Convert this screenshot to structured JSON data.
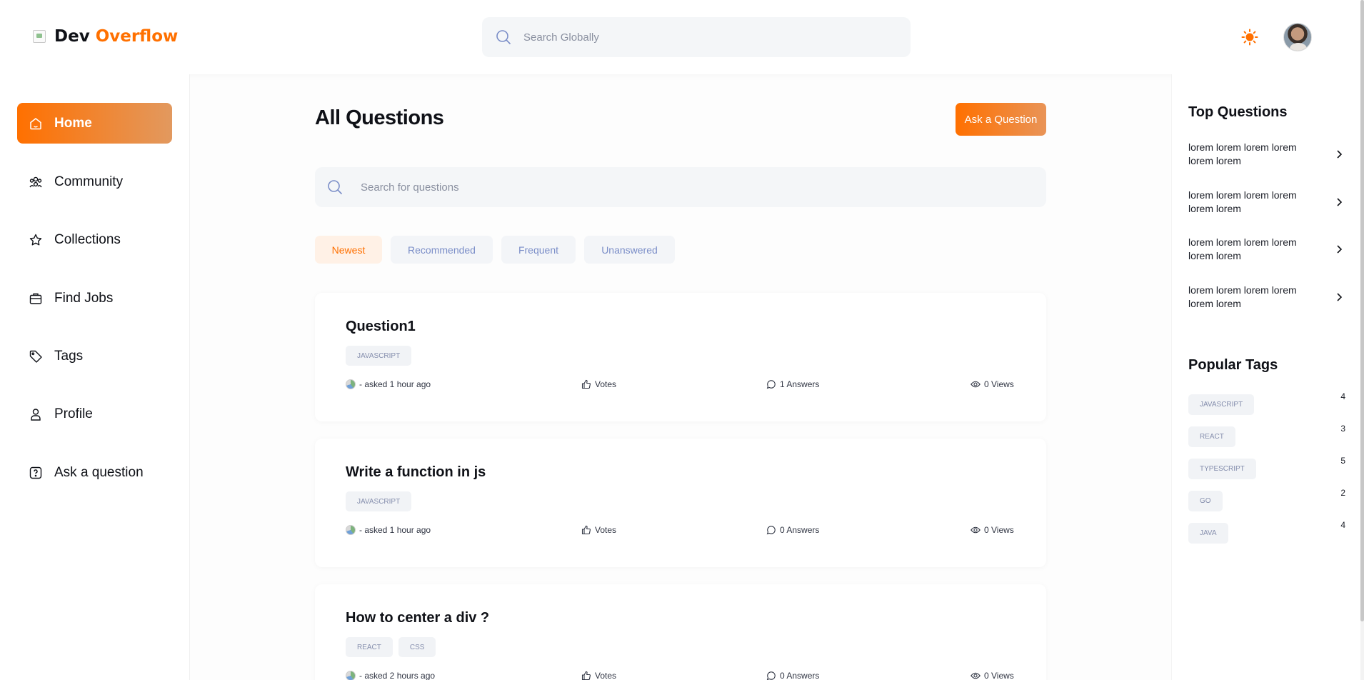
{
  "header": {
    "logo_left": "Dev",
    "logo_right": "Overflow",
    "search_placeholder": "Search Globally"
  },
  "sidebar": {
    "items": [
      {
        "label": "Home",
        "icon": "home-icon",
        "active": true
      },
      {
        "label": "Community",
        "icon": "users-icon"
      },
      {
        "label": "Collections",
        "icon": "star-icon"
      },
      {
        "label": "Find Jobs",
        "icon": "briefcase-icon"
      },
      {
        "label": "Tags",
        "icon": "tag-icon"
      },
      {
        "label": "Profile",
        "icon": "user-icon"
      },
      {
        "label": "Ask a question",
        "icon": "question-icon"
      }
    ]
  },
  "main": {
    "title": "All Questions",
    "ask_button": "Ask a Question",
    "search_placeholder": "Search for questions",
    "filters": [
      "Newest",
      "Recommended",
      "Frequent",
      "Unanswered"
    ],
    "questions": [
      {
        "title": "Question1",
        "tags": [
          "JAVASCRIPT"
        ],
        "asked": "- asked 1 hour ago",
        "votes": "Votes",
        "answers": "1 Answers",
        "views": "0 Views"
      },
      {
        "title": "Write a function in js",
        "tags": [
          "JAVASCRIPT"
        ],
        "asked": "- asked 1 hour ago",
        "votes": "Votes",
        "answers": "0 Answers",
        "views": "0 Views"
      },
      {
        "title": "How to center a div ?",
        "tags": [
          "REACT",
          "CSS"
        ],
        "asked": "- asked 2 hours ago",
        "votes": "Votes",
        "answers": "0 Answers",
        "views": "0 Views"
      }
    ]
  },
  "rightbar": {
    "top_title": "Top Questions",
    "top_questions": [
      "lorem lorem lorem lorem lorem lorem",
      "lorem lorem lorem lorem lorem lorem",
      "lorem lorem lorem lorem lorem lorem",
      "lorem lorem lorem lorem lorem lorem"
    ],
    "tags_title": "Popular Tags",
    "popular_tags": [
      {
        "name": "JAVASCRIPT",
        "count": "4"
      },
      {
        "name": "REACT",
        "count": "3"
      },
      {
        "name": "TYPESCRIPT",
        "count": "5"
      },
      {
        "name": "GO",
        "count": "2"
      },
      {
        "name": "JAVA",
        "count": "4"
      }
    ]
  },
  "colors": {
    "accent": "#ff7000",
    "tag_text": "#858ead",
    "filter_text": "#7b8ec8"
  }
}
